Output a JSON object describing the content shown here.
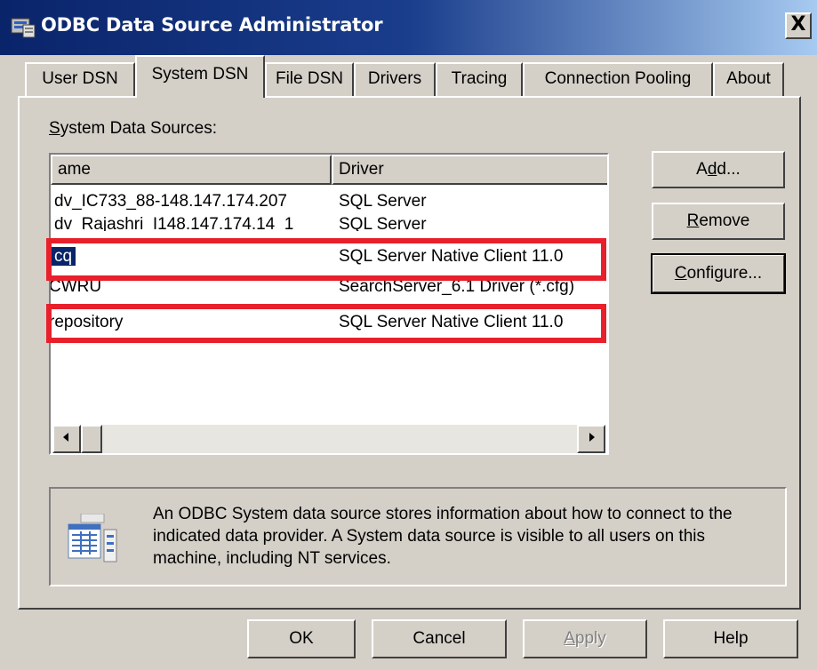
{
  "window": {
    "title": "ODBC Data Source Administrator",
    "close_glyph": "X"
  },
  "tabs": [
    {
      "label": "User DSN",
      "active": false
    },
    {
      "label": "System DSN",
      "active": true
    },
    {
      "label": "File DSN",
      "active": false
    },
    {
      "label": "Drivers",
      "active": false
    },
    {
      "label": "Tracing",
      "active": false
    },
    {
      "label": "Connection Pooling",
      "active": false
    },
    {
      "label": "About",
      "active": false
    }
  ],
  "system_dsn": {
    "label_prefix": "S",
    "label_rest": "ystem Data Sources:",
    "columns": [
      "ame",
      "Driver"
    ],
    "rows": [
      {
        "name": "dv_IC733_88-148.147.174.207",
        "driver": "SQL Server",
        "selected": false,
        "highlighted": false
      },
      {
        "name": "dv_Rajashri_I148.147.174.14_1",
        "driver": "SQL Server",
        "selected": false,
        "highlighted": false
      },
      {
        "name": "cq",
        "driver": "SQL Server Native Client 11.0",
        "selected": true,
        "highlighted": true
      },
      {
        "name": "CWRU",
        "driver": "SearchServer_6.1 Driver (*.cfg)",
        "selected": false,
        "highlighted": false
      },
      {
        "name": "repository",
        "driver": "SQL Server Native Client 11.0",
        "selected": false,
        "highlighted": true
      }
    ]
  },
  "side_buttons": {
    "add": {
      "pre": "A",
      "ul": "d",
      "post": "d..."
    },
    "remove": {
      "pre": "",
      "ul": "R",
      "post": "emove"
    },
    "configure": {
      "pre": "",
      "ul": "C",
      "post": "onfigure..."
    }
  },
  "info": {
    "icon": "odbc-datasource-icon",
    "text": "An ODBC System data source stores information about how to connect to the indicated data provider.  A System data source is visible to all users on this machine, including NT services."
  },
  "bottom_buttons": {
    "ok": "OK",
    "cancel": "Cancel",
    "apply_ul": "A",
    "apply_rest": "pply",
    "help": "Help"
  },
  "colors": {
    "highlight_box": "#e8202b",
    "selection": "#0a246a",
    "face": "#d4d0c8"
  }
}
